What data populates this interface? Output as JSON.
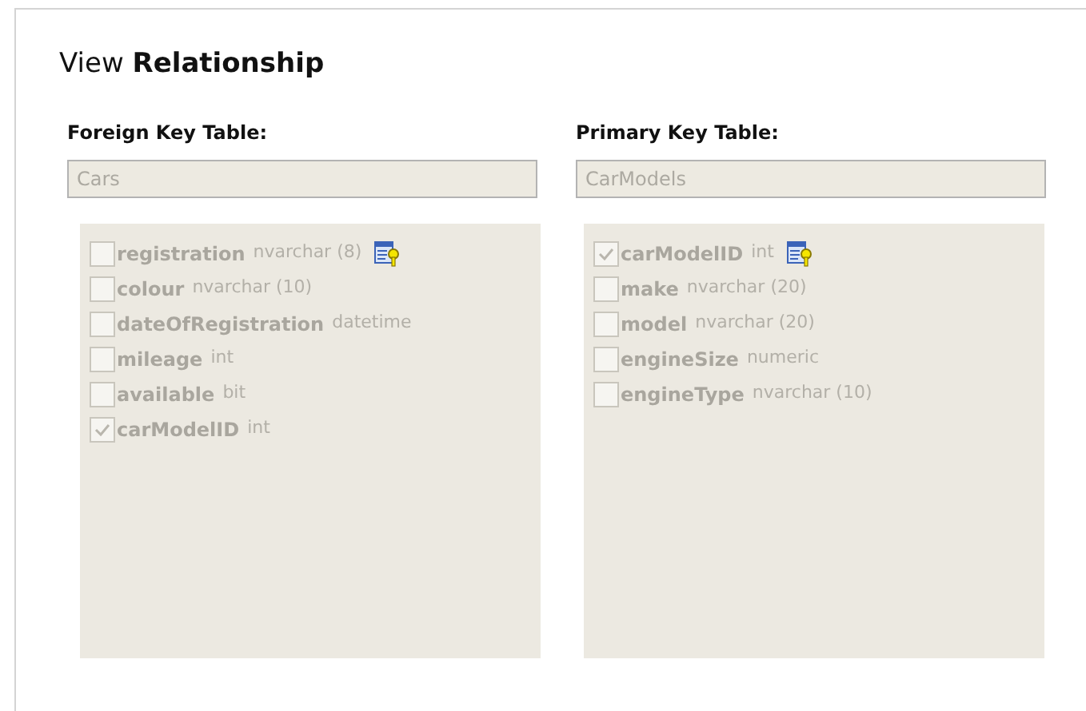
{
  "title": {
    "prefix": "View",
    "bold": "Relationship"
  },
  "tables": [
    {
      "label": "Foreign Key Table:",
      "value": "Cars",
      "columns": [
        {
          "name": "registration",
          "type": "nvarchar (8)",
          "checked": false,
          "key": true
        },
        {
          "name": "colour",
          "type": "nvarchar (10)",
          "checked": false,
          "key": false
        },
        {
          "name": "dateOfRegistration",
          "type": "datetime",
          "checked": false,
          "key": false
        },
        {
          "name": "mileage",
          "type": "int",
          "checked": false,
          "key": false
        },
        {
          "name": "available",
          "type": "bit",
          "checked": false,
          "key": false
        },
        {
          "name": "carModelID",
          "type": "int",
          "checked": true,
          "key": false
        }
      ]
    },
    {
      "label": "Primary Key Table:",
      "value": "CarModels",
      "columns": [
        {
          "name": "carModelID",
          "type": "int",
          "checked": true,
          "key": true
        },
        {
          "name": "make",
          "type": "nvarchar (20)",
          "checked": false,
          "key": false
        },
        {
          "name": "model",
          "type": "nvarchar (20)",
          "checked": false,
          "key": false
        },
        {
          "name": "engineSize",
          "type": "numeric",
          "checked": false,
          "key": false
        },
        {
          "name": "engineType",
          "type": "nvarchar (10)",
          "checked": false,
          "key": false
        }
      ]
    }
  ]
}
